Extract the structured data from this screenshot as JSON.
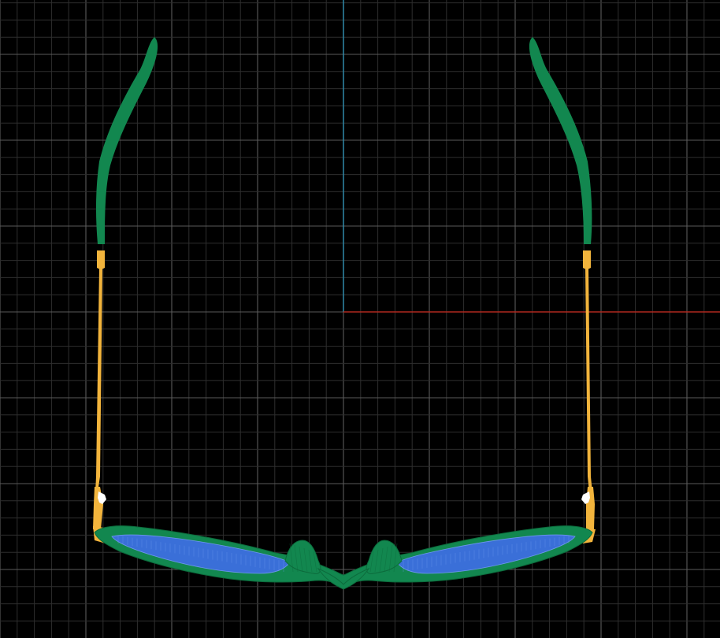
{
  "viewport": {
    "background": "#000000",
    "grid_minor_color": "#2e2e2e",
    "grid_major_color": "#5a5a5a",
    "axis_x_color": "#b0281f",
    "axis_y_color": "#2f8fb0",
    "projection": "top-view",
    "object": "sunglasses-wireframe"
  },
  "model": {
    "frame_color": "#12874f",
    "frame_edge_color": "#0c6b3c",
    "lens_color": "#3a6fd8",
    "lens_wire_color": "#6f98ee",
    "temple_metal_color": "#f2b43c",
    "temple_tip_color": "#12874f",
    "hinge_highlight_color": "#ffffff",
    "icons": [
      "sunglasses-icon"
    ]
  }
}
